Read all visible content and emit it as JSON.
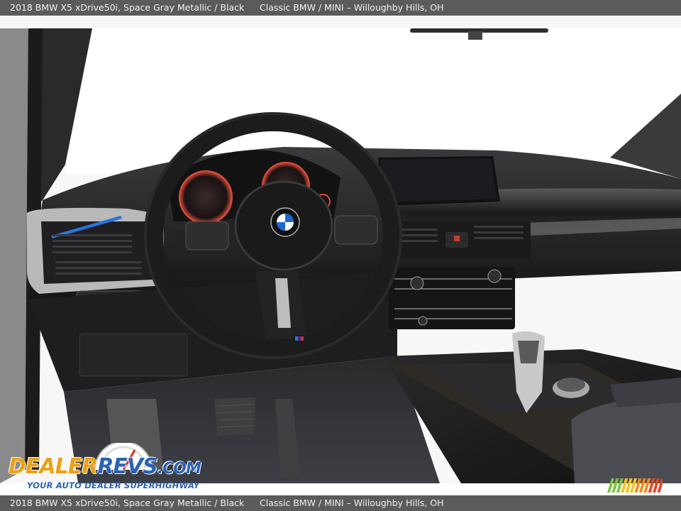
{
  "header": {
    "vehicle": "2018 BMW X5 xDrive50i,  Space Gray Metallic / Black",
    "dealer": "Classic BMW / MINI – Willoughby Hills, OH"
  },
  "footer": {
    "vehicle": "2018 BMW X5 xDrive50i,  Space Gray Metallic / Black",
    "dealer": "Classic BMW / MINI – Willoughby Hills, OH"
  },
  "watermark": {
    "brand": "DealerRevs.com",
    "tagline": "YOUR AUTO DEALER SUPERHIGHWAY"
  },
  "photo": {
    "subject": "dashboard-interior",
    "icons": [
      "bmw-roundel-icon",
      "steering-wheel-icon",
      "gear-shifter-icon",
      "speedometer-icon"
    ]
  },
  "colors": {
    "bar_bg": "#5b5b5b",
    "bar_text": "#f2f2f2",
    "logo_orange": "#e8a21a",
    "logo_blue": "#2c62b4",
    "stripe_colors": [
      "#7dc242",
      "#f7c21b",
      "#f08a1d",
      "#e04a28"
    ]
  }
}
